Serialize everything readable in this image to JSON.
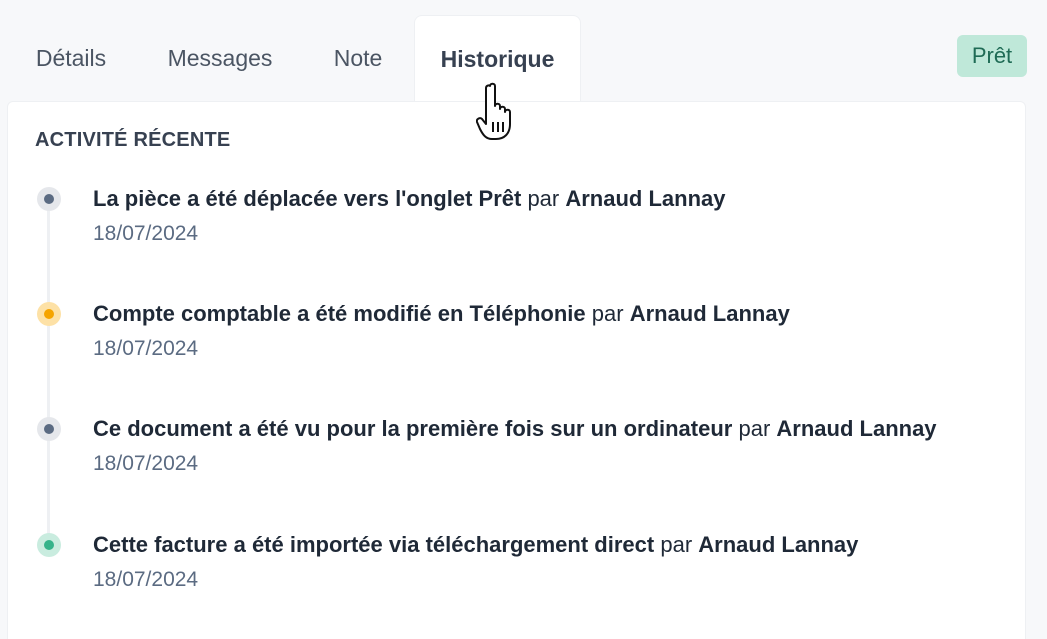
{
  "tabs": [
    {
      "label": "Détails",
      "active": false
    },
    {
      "label": "Messages",
      "active": false
    },
    {
      "label": "Note",
      "active": false
    },
    {
      "label": "Historique",
      "active": true
    }
  ],
  "status_badge": "Prêt",
  "activity": {
    "title": "ACTIVITÉ RÉCENTE",
    "items": [
      {
        "action": "La pièce a été déplacée vers l'onglet Prêt",
        "by": "par",
        "user": "Arnaud Lannay",
        "date": "18/07/2024",
        "color": "#5b6b82",
        "ring": "#e5e7eb"
      },
      {
        "action": "Compte comptable a été modifié en Téléphonie",
        "by": "par",
        "user": "Arnaud Lannay",
        "date": "18/07/2024",
        "color": "#f5a400",
        "ring": "#fde1a6"
      },
      {
        "action": "Ce document a été vu pour la première fois sur un ordinateur",
        "by": "par",
        "user": "Arnaud Lannay",
        "date": "18/07/2024",
        "color": "#5b6b82",
        "ring": "#e5e7eb"
      },
      {
        "action": "Cette facture a été importée via téléchargement direct",
        "by": "par",
        "user": "Arnaud Lannay",
        "date": "18/07/2024",
        "color": "#35b38a",
        "ring": "#c9ecdf"
      }
    ]
  },
  "colors": {
    "accent_green": "#bfe8d9",
    "accent_green_text": "#1f6b55"
  },
  "cursor_icon": "hand-pointer-icon"
}
